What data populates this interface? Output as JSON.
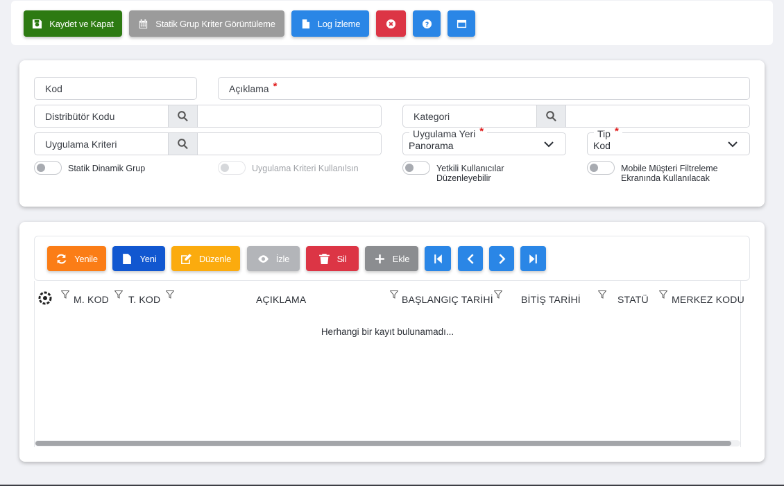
{
  "toolbar": {
    "save_close": "Kaydet ve Kapat",
    "static_group": "Statik Grup Kriter Görüntüleme",
    "log": "Log İzleme"
  },
  "form": {
    "kod_label": "Kod",
    "aciklama_label": "Açıklama",
    "distributor_label": "Distribütör Kodu",
    "kategori_label": "Kategori",
    "uygulama_kriteri_label": "Uygulama Kriteri",
    "uygulama_yeri_label": "Uygulama Yeri",
    "uygulama_yeri_value": "Panorama",
    "tip_label": "Tip",
    "tip_value": "Kod",
    "required_mark": "*",
    "toggles": {
      "statik": "Statik Dinamik Grup",
      "uygulama_kriteri": "Uygulama Kriteri Kullanılsın",
      "yetkili_1": "Yetkili Kullanıcılar",
      "yetkili_2": "Düzenleyebilir",
      "mobile_1": "Mobile Müşteri Filtreleme",
      "mobile_2": "Ekranında Kullanılacak"
    }
  },
  "grid_toolbar": {
    "refresh": "Yenile",
    "new": "Yeni",
    "edit": "Düzenle",
    "view": "İzle",
    "delete": "Sil",
    "add": "Ekle"
  },
  "grid": {
    "columns": [
      "M. KOD",
      "T. KOD",
      "AÇIKLAMA",
      "BAŞLANGIÇ TARİHİ",
      "BİTİŞ TARİHİ",
      "STATÜ",
      "MERKEZ KODU"
    ],
    "empty_text": "Herhangi bir kayıt bulunamadı..."
  }
}
